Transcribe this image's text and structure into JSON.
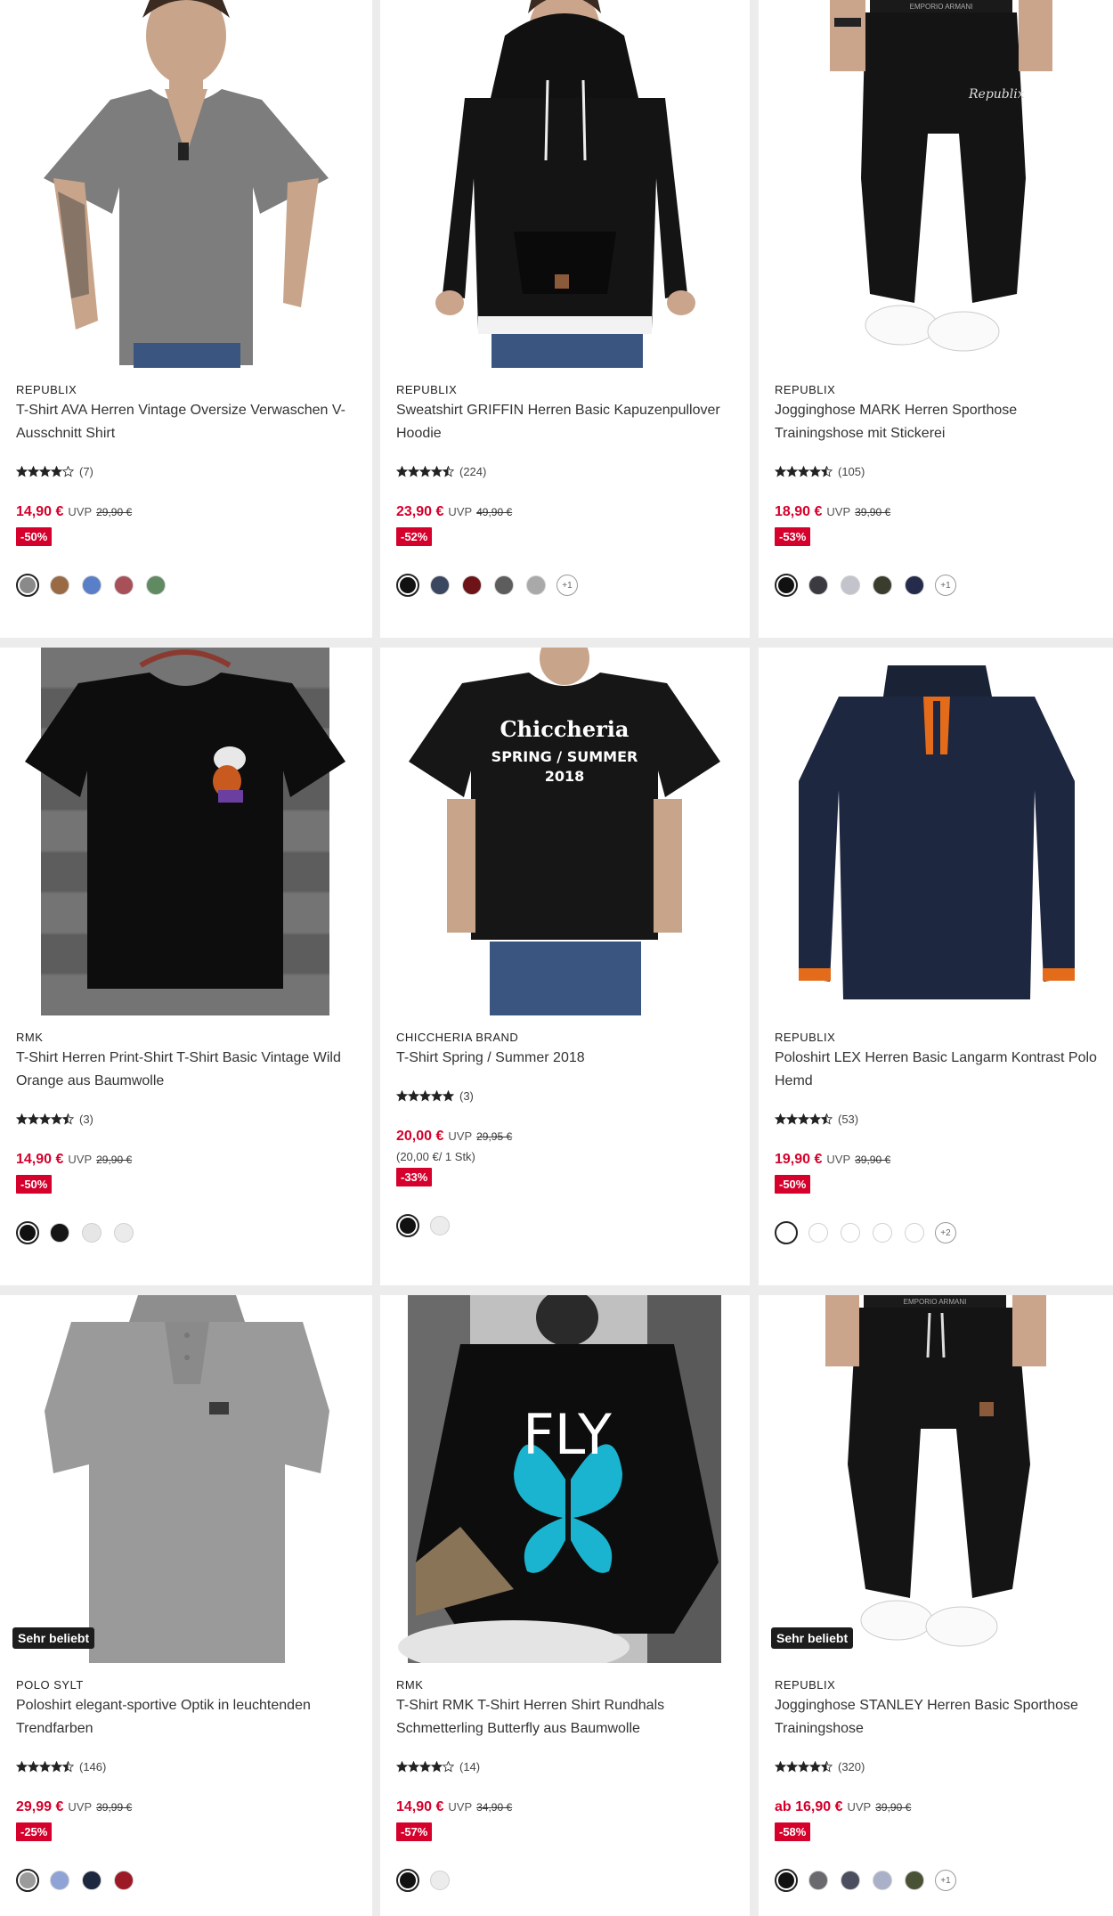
{
  "products": [
    {
      "brand": "REPUBLIX",
      "title": "T-Shirt AVA Herren Vintage Oversize Verwaschen V-Ausschnitt Shirt",
      "rating": 4,
      "rating_count": "(7)",
      "price": "14,90 €",
      "uvp_label": "UVP",
      "old_price": "29,90 €",
      "unit_price": "",
      "discount": "-50%",
      "badge": "",
      "image_icon": "gray-vneck-tshirt-model",
      "swatches": [
        {
          "color": "#8a8a8a",
          "selected": true
        },
        {
          "color": "#9a6a45",
          "selected": false
        },
        {
          "color": "#5a7fc9",
          "selected": false
        },
        {
          "color": "#a85058",
          "selected": false
        },
        {
          "color": "#5f8a62",
          "selected": false
        }
      ],
      "more_colors": ""
    },
    {
      "brand": "REPUBLIX",
      "title": "Sweatshirt GRIFFIN Herren Basic Kapuzenpullover Hoodie",
      "rating": 4.5,
      "rating_count": "(224)",
      "price": "23,90 €",
      "uvp_label": "UVP",
      "old_price": "49,90 €",
      "unit_price": "",
      "discount": "-52%",
      "badge": "",
      "image_icon": "black-hoodie-model",
      "swatches": [
        {
          "color": "#111111",
          "selected": true
        },
        {
          "color": "#3b4660",
          "selected": false
        },
        {
          "color": "#6e1419",
          "selected": false
        },
        {
          "color": "#5d5d5d",
          "selected": false
        },
        {
          "color": "#a9a9a9",
          "selected": false
        }
      ],
      "more_colors": "+1"
    },
    {
      "brand": "REPUBLIX",
      "title": "Jogginghose MARK Herren Sporthose Trainingshose mit Stickerei",
      "rating": 4.5,
      "rating_count": "(105)",
      "price": "18,90 €",
      "uvp_label": "UVP",
      "old_price": "39,90 €",
      "unit_price": "",
      "discount": "-53%",
      "badge": "",
      "image_icon": "black-jogging-pants-model",
      "swatches": [
        {
          "color": "#111111",
          "selected": true
        },
        {
          "color": "#3a3a40",
          "selected": false
        },
        {
          "color": "#c3c3cc",
          "selected": false
        },
        {
          "color": "#3a3d2e",
          "selected": false
        },
        {
          "color": "#252b4a",
          "selected": false
        }
      ],
      "more_colors": "+1"
    },
    {
      "brand": "RMK",
      "title": "T-Shirt Herren Print-Shirt T-Shirt Basic Vintage Wild Orange aus Baumwolle",
      "rating": 4.5,
      "rating_count": "(3)",
      "price": "14,90 €",
      "uvp_label": "UVP",
      "old_price": "29,90 €",
      "unit_price": "",
      "discount": "-50%",
      "badge": "",
      "image_icon": "black-printed-tshirt-hanger",
      "swatches": [
        {
          "color": "#111111",
          "selected": true
        },
        {
          "color": "#151515",
          "selected": false
        },
        {
          "color": "#e6e6e6",
          "selected": false
        },
        {
          "color": "#ebebeb",
          "selected": false
        }
      ],
      "more_colors": ""
    },
    {
      "brand": "CHICCHERIA BRAND",
      "title": "T-Shirt Spring / Summer 2018",
      "rating": 5,
      "rating_count": "(3)",
      "price": "20,00 €",
      "uvp_label": "UVP",
      "old_price": "29,95 €",
      "unit_price": "(20,00 €/ 1 Stk)",
      "discount": "-33%",
      "badge": "",
      "image_icon": "black-tshirt-spring-summer-model",
      "print_line1": "Chiccheria",
      "print_line2": "SPRING / SUMMER",
      "print_line3": "2018",
      "swatches": [
        {
          "color": "#111111",
          "selected": true
        },
        {
          "color": "#ececec",
          "selected": false
        }
      ],
      "more_colors": ""
    },
    {
      "brand": "REPUBLIX",
      "title": "Poloshirt LEX Herren Basic Langarm Kontrast Polo Hemd",
      "rating": 4.5,
      "rating_count": "(53)",
      "price": "19,90 €",
      "uvp_label": "UVP",
      "old_price": "39,90 €",
      "unit_price": "",
      "discount": "-50%",
      "badge": "",
      "image_icon": "navy-longsleeve-polo",
      "swatches": [
        {
          "color": "#ffffff",
          "selected": true
        },
        {
          "color": "#ffffff",
          "selected": false
        },
        {
          "color": "#ffffff",
          "selected": false
        },
        {
          "color": "#ffffff",
          "selected": false
        },
        {
          "color": "#ffffff",
          "selected": false
        }
      ],
      "more_colors": "+2"
    },
    {
      "brand": "POLO SYLT",
      "title": "Poloshirt elegant-sportive Optik in leuchtenden Trendfarben",
      "rating": 4.5,
      "rating_count": "(146)",
      "price": "29,99 €",
      "uvp_label": "UVP",
      "old_price": "39,99 €",
      "unit_price": "",
      "discount": "-25%",
      "badge": "Sehr beliebt",
      "image_icon": "gray-polo-shirt",
      "swatches": [
        {
          "color": "#9b9b9b",
          "selected": true
        },
        {
          "color": "#8fa3d6",
          "selected": false
        },
        {
          "color": "#1d2740",
          "selected": false
        },
        {
          "color": "#9c1a25",
          "selected": false
        }
      ],
      "more_colors": ""
    },
    {
      "brand": "RMK",
      "title": "T-Shirt RMK T-Shirt Herren Shirt Rundhals Schmetterling Butterfly aus Baumwolle",
      "rating": 4,
      "rating_count": "(14)",
      "price": "14,90 €",
      "uvp_label": "UVP",
      "old_price": "34,90 €",
      "unit_price": "",
      "discount": "-57%",
      "badge": "",
      "image_icon": "black-butterfly-tshirt-back",
      "print_line1": "FLY",
      "swatches": [
        {
          "color": "#111111",
          "selected": true
        },
        {
          "color": "#ececec",
          "selected": false
        }
      ],
      "more_colors": ""
    },
    {
      "brand": "REPUBLIX",
      "title": "Jogginghose STANLEY Herren Basic Sporthose Trainingshose",
      "rating": 4.5,
      "rating_count": "(320)",
      "price": "ab 16,90 €",
      "uvp_label": "UVP",
      "old_price": "39,90 €",
      "unit_price": "",
      "discount": "-58%",
      "badge": "Sehr beliebt",
      "image_icon": "black-jogging-pants-stanley",
      "swatches": [
        {
          "color": "#111111",
          "selected": true
        },
        {
          "color": "#6a6a6e",
          "selected": false
        },
        {
          "color": "#4a4e5e",
          "selected": false
        },
        {
          "color": "#a9b0c8",
          "selected": false
        },
        {
          "color": "#4a5236",
          "selected": false
        }
      ],
      "more_colors": "+1"
    }
  ]
}
